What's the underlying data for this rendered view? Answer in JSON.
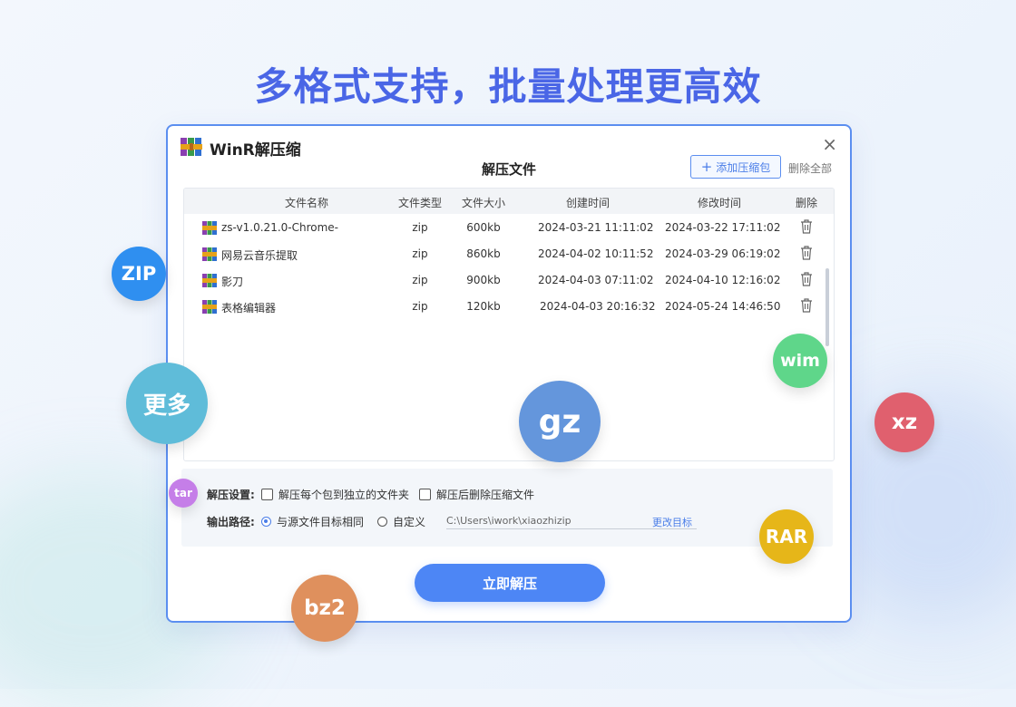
{
  "headline": "多格式支持，批量处理更高效",
  "window": {
    "app_title": "WinR解压缩",
    "panel_title": "解压文件",
    "add_button": "添加压缩包",
    "clear_button": "删除全部",
    "close": "×"
  },
  "table": {
    "columns": {
      "name": "文件名称",
      "type": "文件类型",
      "size": "文件大小",
      "created": "创建时间",
      "modified": "修改时间",
      "delete": "删除"
    },
    "rows": [
      {
        "name": "zs-v1.0.21.0-Chrome-",
        "type": "zip",
        "size": "600kb",
        "created": "2024-03-21  11:11:02",
        "modified": "2024-03-22  17:11:02"
      },
      {
        "name": "网易云音乐提取",
        "type": "zip",
        "size": "860kb",
        "created": "2024-04-02  10:11:52",
        "modified": "2024-03-29  06:19:02"
      },
      {
        "name": "影刀",
        "type": "zip",
        "size": "900kb",
        "created": "2024-04-03  07:11:02",
        "modified": "2024-04-10  12:16:02"
      },
      {
        "name": "表格编辑器",
        "type": "zip",
        "size": "120kb",
        "created": "2024-04-03 20:16:32",
        "modified": "2024-05-24  14:46:50"
      }
    ]
  },
  "settings": {
    "extract_label": "解压设置:",
    "opt_separate_folder": "解压每个包到独立的文件夹",
    "opt_delete_after": "解压后删除压缩文件",
    "output_label": "输出路径:",
    "opt_same_as_source": "与源文件目标相同",
    "opt_custom": "自定义",
    "path_value": "C:\\Users\\iwork\\xiaozhizip",
    "change_target": "更改目标"
  },
  "extract_button": "立即解压",
  "formats": {
    "zip": "ZIP",
    "more": "更多",
    "gz": "gz",
    "wim": "wim",
    "xz": "xz",
    "tar": "tar",
    "rar": "RAR",
    "bz2": "bz2"
  },
  "colors": {
    "accent": "#4d86f5",
    "headline": "#4a66e6",
    "zip": "#2f8ff0",
    "more": "#5fbcd9",
    "gz": "#6496dc",
    "wim": "#5fd68a",
    "xz": "#e0606e",
    "tar": "#c57ee8",
    "rar": "#e6b619",
    "bz2": "#df905d"
  },
  "icons": {
    "app_logo": "winrar-books-icon",
    "file": "archive-file-icon",
    "delete": "trash-icon",
    "add": "plus-icon",
    "close": "close-icon"
  }
}
